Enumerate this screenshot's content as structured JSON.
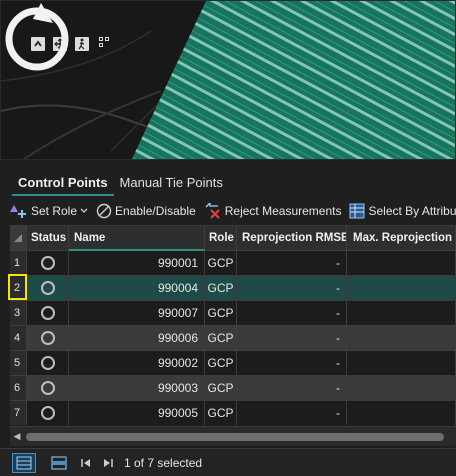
{
  "tabs": [
    {
      "label": "Control Points",
      "active": true
    },
    {
      "label": "Manual Tie Points",
      "active": false
    }
  ],
  "toolbar": {
    "set_role": "Set Role",
    "enable_disable": "Enable/Disable",
    "reject": "Reject Measurements",
    "select_by_attr": "Select By Attribute"
  },
  "table": {
    "columns": {
      "status": "Status",
      "name": "Name",
      "role": "Role",
      "rmse": "Reprojection RMSE",
      "max": "Max. Reprojection Er"
    },
    "rows": [
      {
        "num": "1",
        "name": "990001",
        "role": "GCP",
        "rmse": "-",
        "max": ""
      },
      {
        "num": "2",
        "name": "990004",
        "role": "GCP",
        "rmse": "-",
        "max": ""
      },
      {
        "num": "3",
        "name": "990007",
        "role": "GCP",
        "rmse": "-",
        "max": ""
      },
      {
        "num": "4",
        "name": "990006",
        "role": "GCP",
        "rmse": "-",
        "max": ""
      },
      {
        "num": "5",
        "name": "990002",
        "role": "GCP",
        "rmse": "-",
        "max": ""
      },
      {
        "num": "6",
        "name": "990003",
        "role": "GCP",
        "rmse": "-",
        "max": ""
      },
      {
        "num": "7",
        "name": "990005",
        "role": "GCP",
        "rmse": "-",
        "max": ""
      }
    ]
  },
  "statusbar": {
    "selection_text": "1 of 7 selected"
  },
  "colors": {
    "accent": "#2f8f82",
    "selected_row": "#1e4b48",
    "highlight": "#f3e600"
  }
}
